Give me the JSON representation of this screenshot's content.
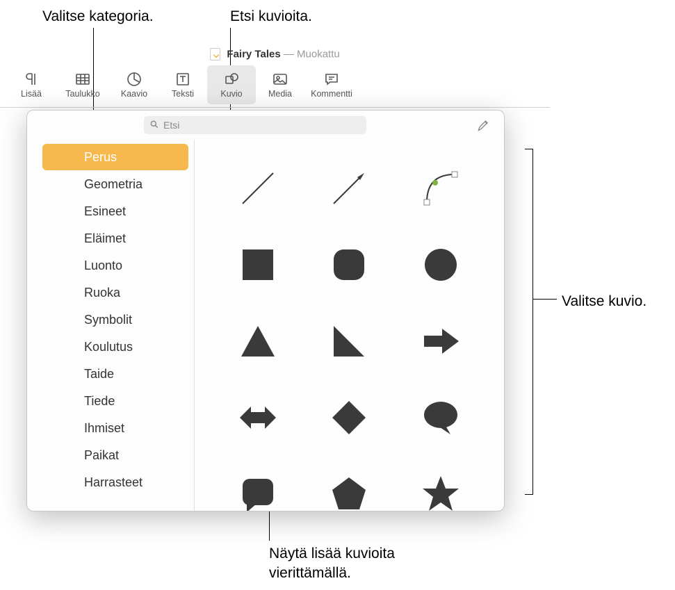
{
  "callouts": {
    "category": "Valitse kategoria.",
    "search": "Etsi kuvioita.",
    "choose": "Valitse kuvio.",
    "scroll": "Näytä lisää kuvioita\nvierittämällä."
  },
  "titlebar": {
    "document": "Fairy Tales",
    "separator": " — ",
    "modified": "Muokattu"
  },
  "toolbar": {
    "items": [
      {
        "label": "Lisää",
        "icon": "paragraph"
      },
      {
        "label": "Taulukko",
        "icon": "table"
      },
      {
        "label": "Kaavio",
        "icon": "chart"
      },
      {
        "label": "Teksti",
        "icon": "text"
      },
      {
        "label": "Kuvio",
        "icon": "shape"
      },
      {
        "label": "Media",
        "icon": "media"
      },
      {
        "label": "Kommentti",
        "icon": "comment"
      }
    ]
  },
  "search": {
    "placeholder": "Etsi"
  },
  "sidebar": {
    "items": [
      "Perus",
      "Geometria",
      "Esineet",
      "Eläimet",
      "Luonto",
      "Ruoka",
      "Symbolit",
      "Koulutus",
      "Taide",
      "Tiede",
      "Ihmiset",
      "Paikat",
      "Harrasteet"
    ],
    "selected": 0
  },
  "shapes": [
    "line",
    "arrow-line",
    "curve",
    "square",
    "rounded-square",
    "circle",
    "triangle",
    "right-triangle",
    "arrow-right",
    "arrow-both",
    "diamond",
    "speech-bubble",
    "callout-box",
    "pentagon",
    "star"
  ]
}
